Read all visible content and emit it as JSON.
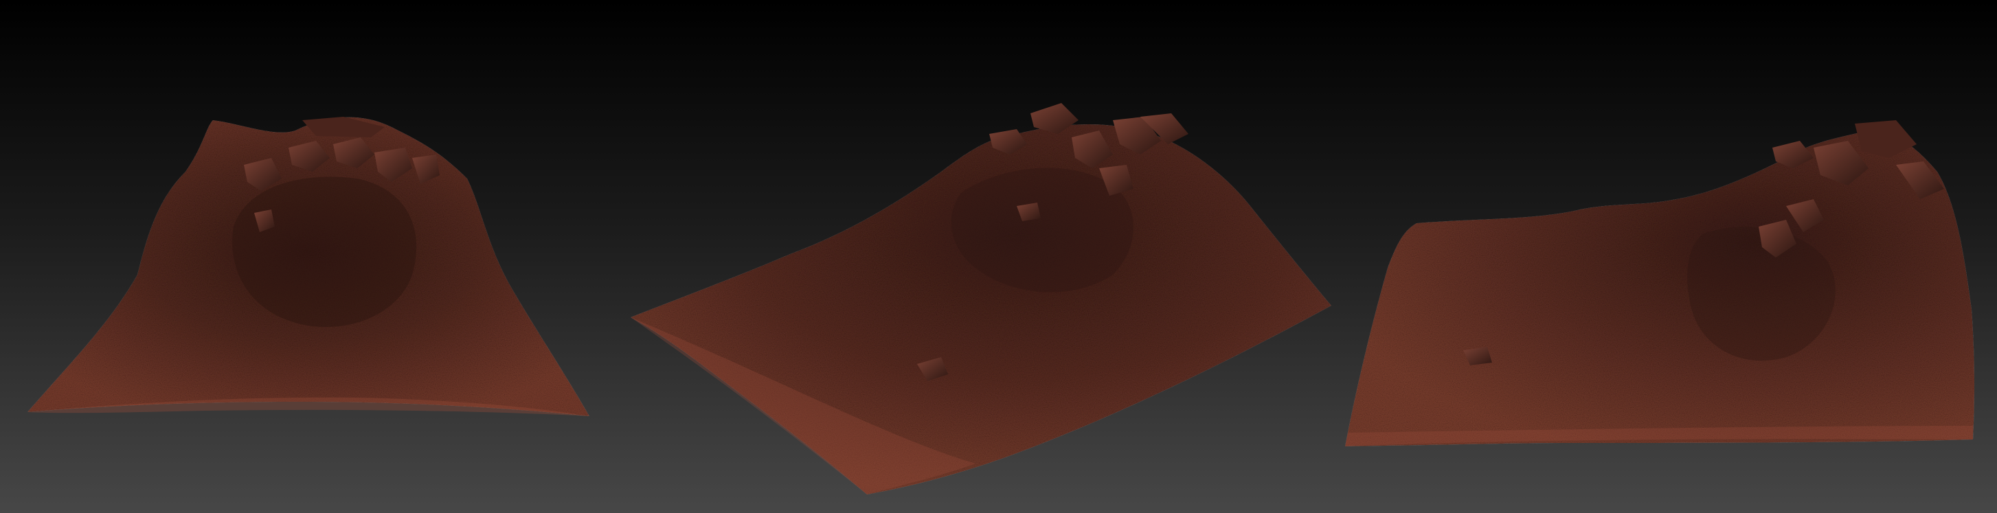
{
  "scene": {
    "background_gradient": [
      "#000000",
      "#1f1f1f",
      "#444444"
    ],
    "sculpt_base_color": "#5a2b22",
    "sculpt_highlight_color": "#8a4636",
    "sculpt_shadow_color": "#2a1410",
    "models": [
      {
        "view": "front"
      },
      {
        "view": "angled-left"
      },
      {
        "view": "angled-right"
      }
    ]
  }
}
